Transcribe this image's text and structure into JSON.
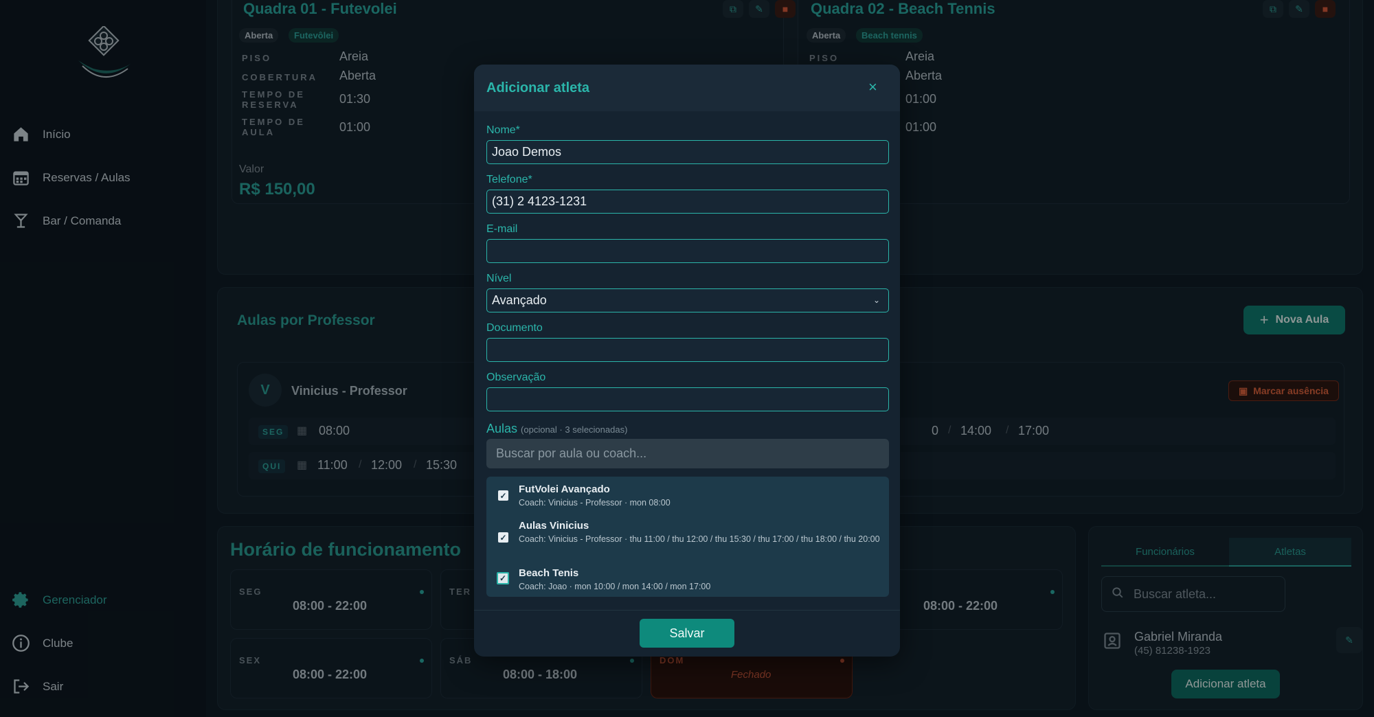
{
  "sidebar": {
    "items": [
      {
        "label": "Início",
        "icon": "home-icon"
      },
      {
        "label": "Reservas / Aulas",
        "icon": "calendar-icon"
      },
      {
        "label": "Bar / Comanda",
        "icon": "cocktail-icon"
      }
    ],
    "bottom": [
      {
        "label": "Gerenciador",
        "icon": "gear-icon"
      },
      {
        "label": "Clube",
        "icon": "info-icon"
      },
      {
        "label": "Sair",
        "icon": "logout-icon"
      }
    ]
  },
  "courts": [
    {
      "title": "Quadra 01 - Futevolei",
      "chips": [
        "Aberta",
        "Futevôlei"
      ],
      "props": [
        {
          "label": "PISO",
          "value": "Areia"
        },
        {
          "label": "COBERTURA",
          "value": "Aberta"
        },
        {
          "label": "TEMPO DE RESERVA",
          "value": "01:30"
        },
        {
          "label": "TEMPO DE AULA",
          "value": "01:00"
        }
      ],
      "valor_label": "Valor",
      "valor": "R$ 150,00"
    },
    {
      "title": "Quadra 02 - Beach Tennis",
      "chips": [
        "Aberta",
        "Beach tennis"
      ],
      "props": [
        {
          "label": "PISO",
          "value": "Areia"
        },
        {
          "label": "COBERTURA",
          "value": "Aberta"
        },
        {
          "label": "TEMPO DE RESERVA",
          "value": "01:00"
        },
        {
          "label": "TEMPO DE AULA",
          "value": "01:00"
        }
      ]
    }
  ],
  "aulas": {
    "title": "Aulas por Professor",
    "new_button": "Nova Aula",
    "professor": {
      "initial": "V",
      "name": "Vinicius - Professor"
    },
    "absence_button": "Marcar ausência",
    "rows": [
      {
        "day": "SEG",
        "times": [
          "08:00"
        ],
        "right_times": [
          "0",
          "14:00",
          "17:00"
        ]
      },
      {
        "day": "QUI",
        "times": [
          "11:00",
          "12:00",
          "15:30"
        ]
      }
    ]
  },
  "horario": {
    "title": "Horário de funcionamento",
    "days": [
      {
        "day": "SEG",
        "time": "08:00 - 22:00"
      },
      {
        "day": "TER",
        "time": ""
      },
      {
        "day": "",
        "time": "08:00 - 22:00"
      },
      {
        "day": "SEX",
        "time": "08:00 - 22:00"
      },
      {
        "day": "SÁB",
        "time": "08:00 - 18:00"
      },
      {
        "day": "DOM",
        "time": "Fechado"
      }
    ]
  },
  "people": {
    "tabs": [
      "Funcionários",
      "Atletas"
    ],
    "search_placeholder": "Buscar atleta...",
    "athlete": {
      "name": "Gabriel Miranda",
      "phone": "(45) 81238-1923"
    },
    "add_button": "Adicionar atleta"
  },
  "modal": {
    "title": "Adicionar atleta",
    "fields": {
      "nome": {
        "label": "Nome*",
        "value": "Joao Demos"
      },
      "telefone": {
        "label": "Telefone*",
        "value": "(31) 2 4123-1231"
      },
      "email": {
        "label": "E-mail",
        "value": ""
      },
      "nivel": {
        "label": "Nível",
        "value": "Avançado"
      },
      "documento": {
        "label": "Documento",
        "value": ""
      },
      "observacao": {
        "label": "Observação",
        "value": ""
      }
    },
    "aulas_label": "Aulas",
    "aulas_sub": "(opcional · 3 selecionadas)",
    "aulas_search_placeholder": "Buscar por aula ou coach...",
    "aulas_list": [
      {
        "name": "FutVolei Avançado",
        "meta": "Coach: Vinicius - Professor · mon 08:00",
        "checked": true
      },
      {
        "name": "Aulas Vinicius",
        "meta": "Coach: Vinicius - Professor · thu 11:00 / thu 12:00 / thu 15:30 / thu 17:00 / thu 18:00 / thu 20:00",
        "checked": true
      },
      {
        "name": "Beach Tenis",
        "meta": "Coach: Joao · mon 10:00 / mon 14:00 / mon 17:00",
        "checked": true
      }
    ],
    "save_label": "Salvar"
  },
  "colors": {
    "accent": "#2bb5aa",
    "background": "#0b151e",
    "danger": "#d45a3a"
  }
}
